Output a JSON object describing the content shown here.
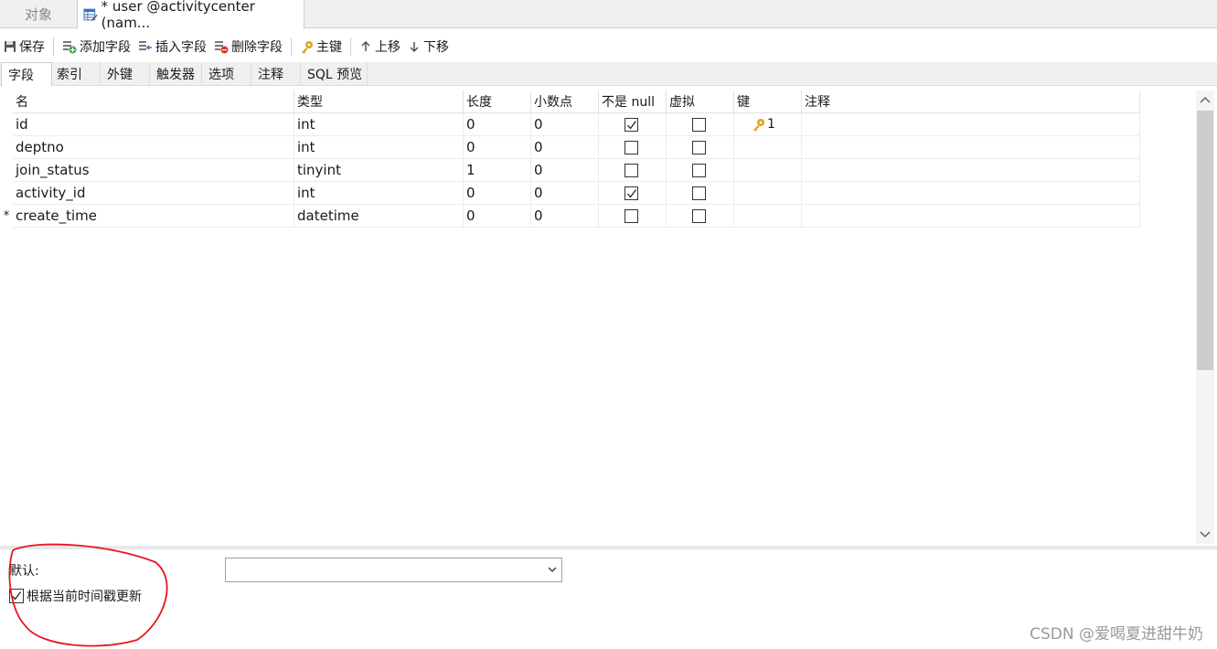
{
  "doc_tabs": {
    "objects_label": "对象",
    "active_label": "* user @activitycenter (nam..."
  },
  "toolbar": {
    "save": "保存",
    "add_field": "添加字段",
    "insert_field": "插入字段",
    "delete_field": "删除字段",
    "primary_key": "主键",
    "move_up": "上移",
    "move_down": "下移"
  },
  "sub_tabs": [
    "字段",
    "索引",
    "外键",
    "触发器",
    "选项",
    "注释",
    "SQL 预览"
  ],
  "grid": {
    "columns": [
      "名",
      "类型",
      "长度",
      "小数点",
      "不是 null",
      "虚拟",
      "键",
      "注释"
    ],
    "rows": [
      {
        "marker": "",
        "name": "id",
        "type": "int",
        "length": "0",
        "decimals": "0",
        "not_null": true,
        "virtual": false,
        "key": "1",
        "comment": ""
      },
      {
        "marker": "",
        "name": "deptno",
        "type": "int",
        "length": "0",
        "decimals": "0",
        "not_null": false,
        "virtual": false,
        "key": "",
        "comment": ""
      },
      {
        "marker": "",
        "name": "join_status",
        "type": "tinyint",
        "length": "1",
        "decimals": "0",
        "not_null": false,
        "virtual": false,
        "key": "",
        "comment": ""
      },
      {
        "marker": "",
        "name": "activity_id",
        "type": "int",
        "length": "0",
        "decimals": "0",
        "not_null": true,
        "virtual": false,
        "key": "",
        "comment": ""
      },
      {
        "marker": "*",
        "name": "create_time",
        "type": "datetime",
        "length": "0",
        "decimals": "0",
        "not_null": false,
        "virtual": false,
        "key": "",
        "comment": ""
      }
    ]
  },
  "bottom": {
    "default_label": "默认:",
    "default_value": "",
    "on_update_label": "根据当前时间戳更新",
    "on_update_checked": true
  },
  "watermark": "CSDN @爱喝夏进甜牛奶",
  "colors": {
    "annotation": "#e8141c",
    "key_icon": "#e3a21a"
  }
}
